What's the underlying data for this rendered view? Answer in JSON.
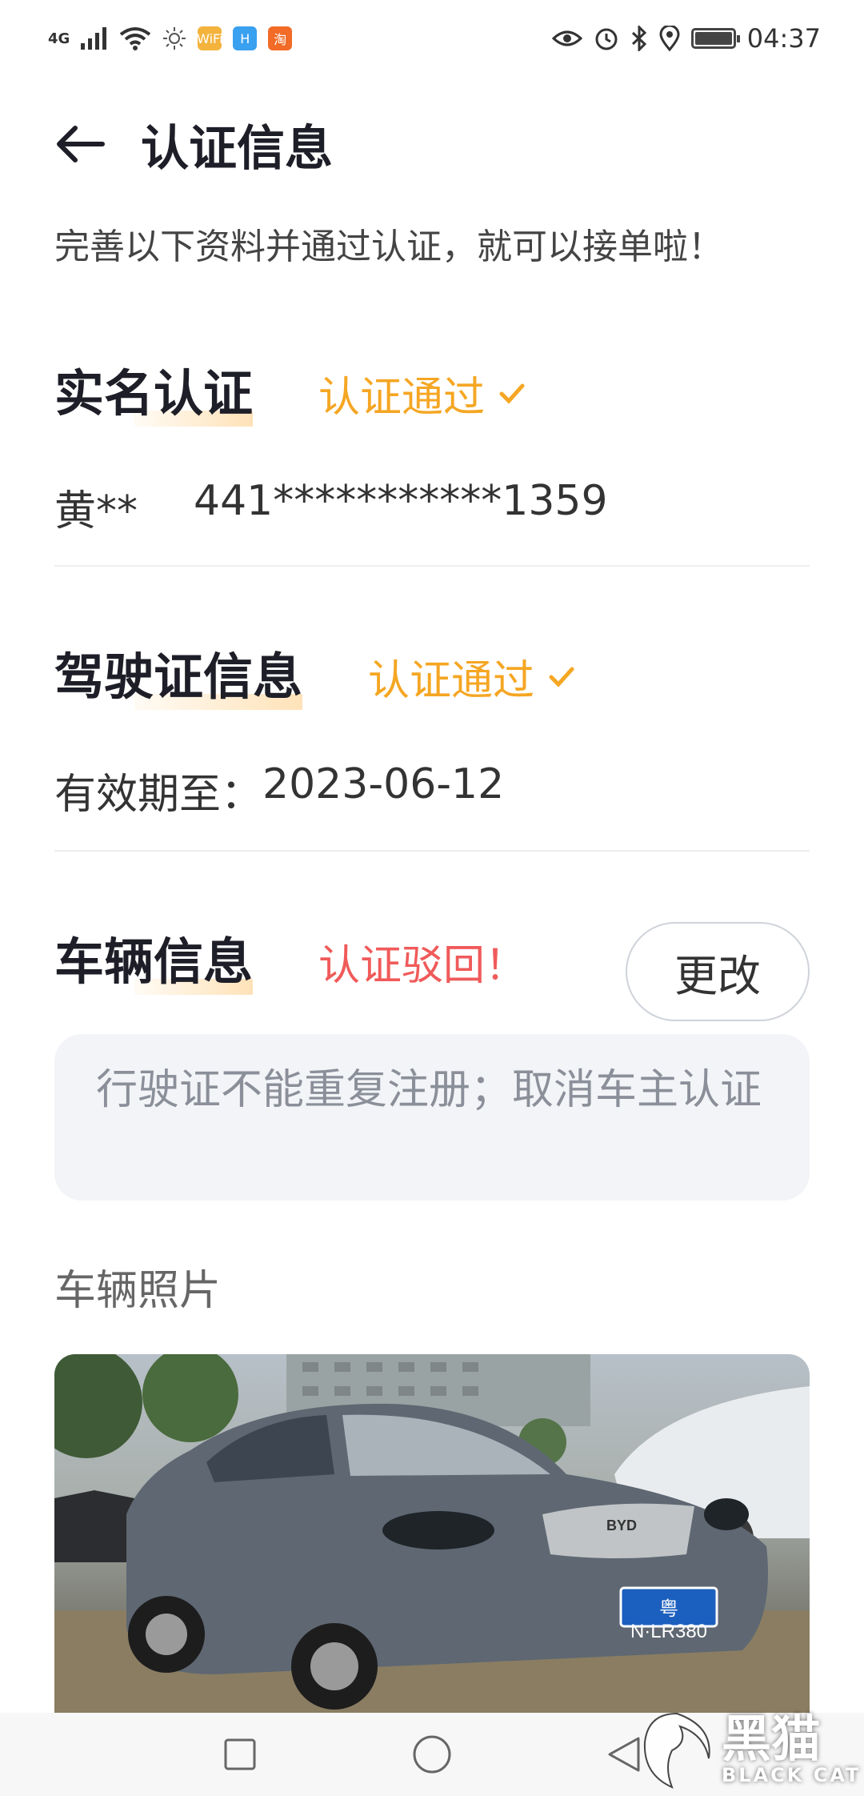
{
  "status_bar": {
    "network": "4G",
    "apps": [
      {
        "icon": "app-badge-yellow-icon",
        "label": "WiFi",
        "color": "#f3b33d"
      },
      {
        "icon": "app-badge-blue-icon",
        "label": "H",
        "color": "#3aa0f0"
      },
      {
        "icon": "taobao-icon",
        "label": "淘",
        "color": "#f26c27"
      }
    ],
    "time": "04:37"
  },
  "header": {
    "back_icon": "arrow-left-icon",
    "title": "认证信息"
  },
  "subtitle": "完善以下资料并通过认证，就可以接单啦！",
  "real_name": {
    "title": "实名认证",
    "status": "认证通过",
    "name": "黄**",
    "id_number": "441***********1359"
  },
  "license": {
    "title": "驾驶证信息",
    "status": "认证通过",
    "expiry_label": "有效期至：",
    "expiry_date": "2023-06-12"
  },
  "vehicle": {
    "title": "车辆信息",
    "status": "认证驳回！",
    "edit_label": "更改",
    "reject_reason": "行驶证不能重复注册；取消车主认证",
    "photo_label": "车辆照片",
    "plate": "粤N·LR380",
    "badge": "BYD"
  },
  "nav": {
    "icons": [
      "recent-apps-icon",
      "home-icon",
      "back-triangle-icon"
    ]
  },
  "watermark": {
    "cn": "黑猫",
    "en": "BLACK CAT"
  },
  "colors": {
    "accent_ok": "#f5a623",
    "accent_bad": "#f05a5a",
    "title_underline": "#ffe2b8"
  }
}
